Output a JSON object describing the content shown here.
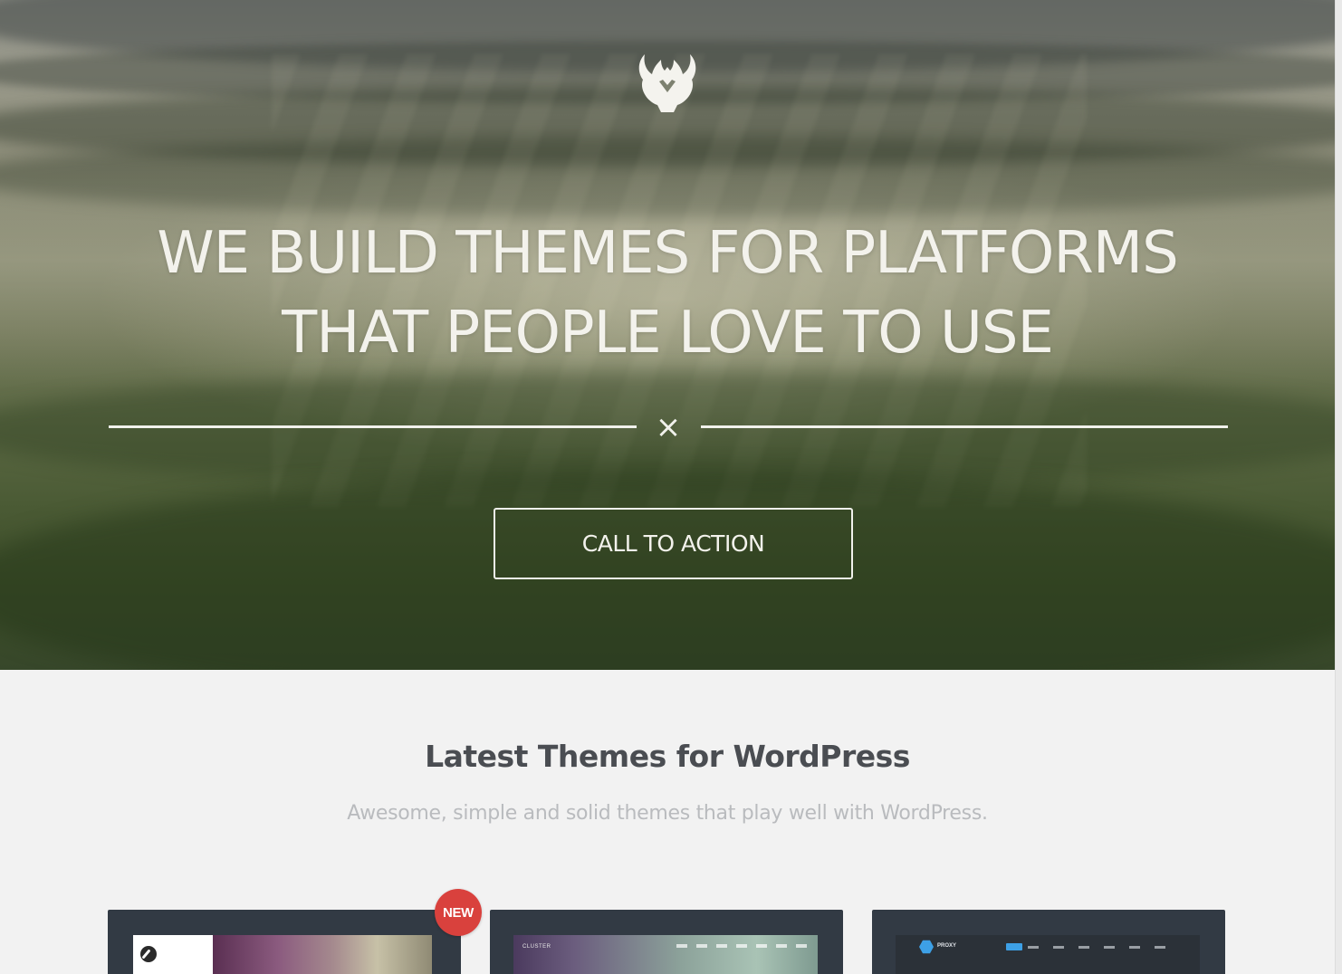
{
  "hero": {
    "headline_line1": "WE BUILD THEMES FOR PLATFORMS",
    "headline_line2": "THAT PEOPLE LOVE TO USE",
    "divider_symbol": "×",
    "cta_label": "CALL TO ACTION",
    "logo_icon": "deer-head-logo-icon"
  },
  "section": {
    "title": "Latest Themes for WordPress",
    "subtitle": "Awesome, simple and solid themes that play well with WordPress."
  },
  "themes": [
    {
      "badge": "NEW",
      "icon": "compass-icon"
    },
    {
      "brand": "CLUSTER"
    },
    {
      "brand": "PROXY",
      "icon": "hexagon-icon"
    }
  ],
  "colors": {
    "badge_red": "#d9413d",
    "card_dark": "#323a44",
    "title_gray": "#4a4d52",
    "subtitle_gray": "#b9bbbe",
    "accent_blue": "#3da0e6"
  }
}
